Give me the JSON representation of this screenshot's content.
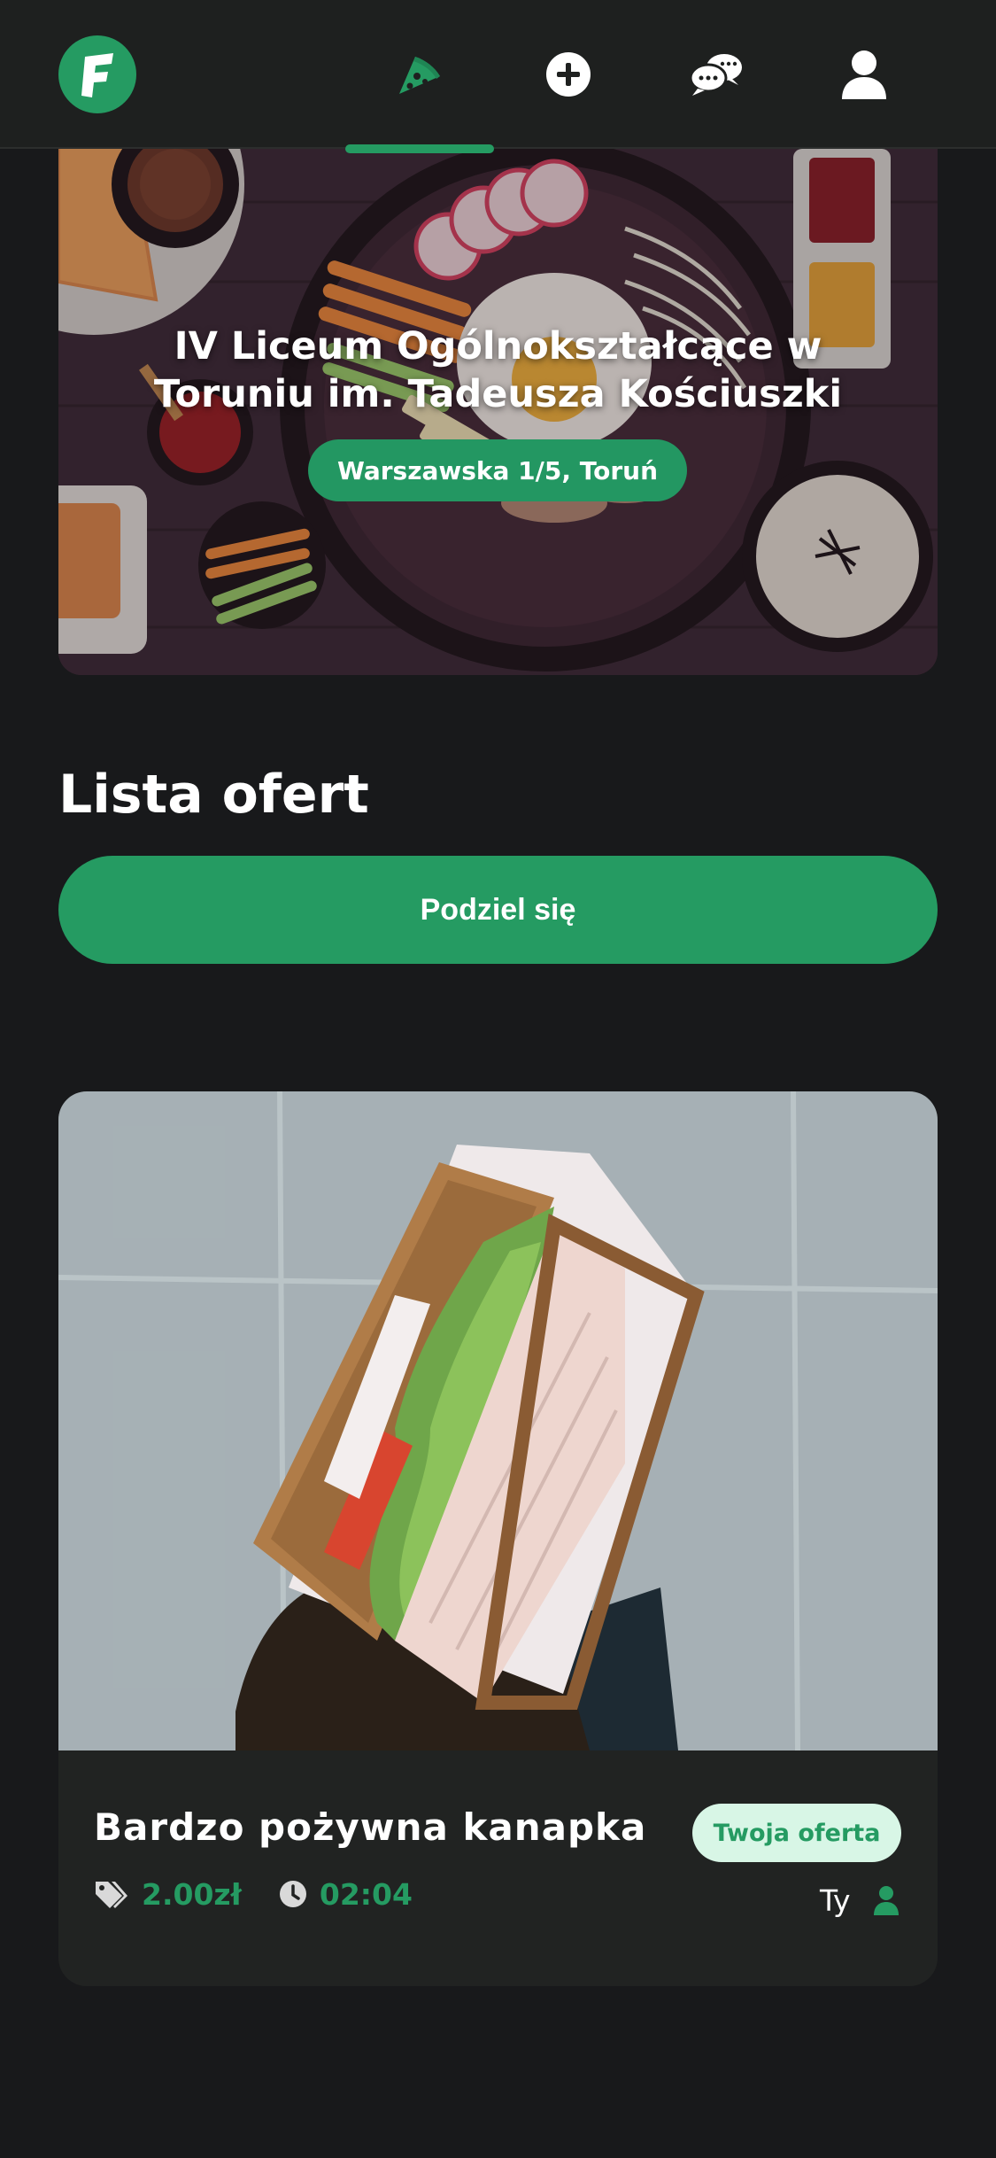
{
  "nav": {
    "logo_letter": "F",
    "items": [
      {
        "name": "food",
        "icon": "pizza-slice-icon",
        "active": true
      },
      {
        "name": "add",
        "icon": "plus-circle-icon",
        "active": false
      },
      {
        "name": "chat",
        "icon": "chat-bubbles-icon",
        "active": false
      },
      {
        "name": "profile",
        "icon": "user-icon",
        "active": false
      }
    ]
  },
  "hero": {
    "title": "IV Liceum Ogólnokształcące w Toruniu im. Tadeusza Kościuszki",
    "address": "Warszawska 1/5, Toruń"
  },
  "offers": {
    "section_title": "Lista ofert",
    "share_label": "Podziel się",
    "items": [
      {
        "title": "Bardzo  pożywna  kanapka",
        "price": "2.00zł",
        "time": "02:04",
        "badge": "Twoja oferta",
        "owner": "Ty",
        "image": "sandwich-photo"
      }
    ]
  },
  "colors": {
    "accent": "#259b62",
    "background": "#18191b",
    "header": "#1e201f",
    "card": "#212322",
    "badge_bg": "#d8f6e6"
  }
}
